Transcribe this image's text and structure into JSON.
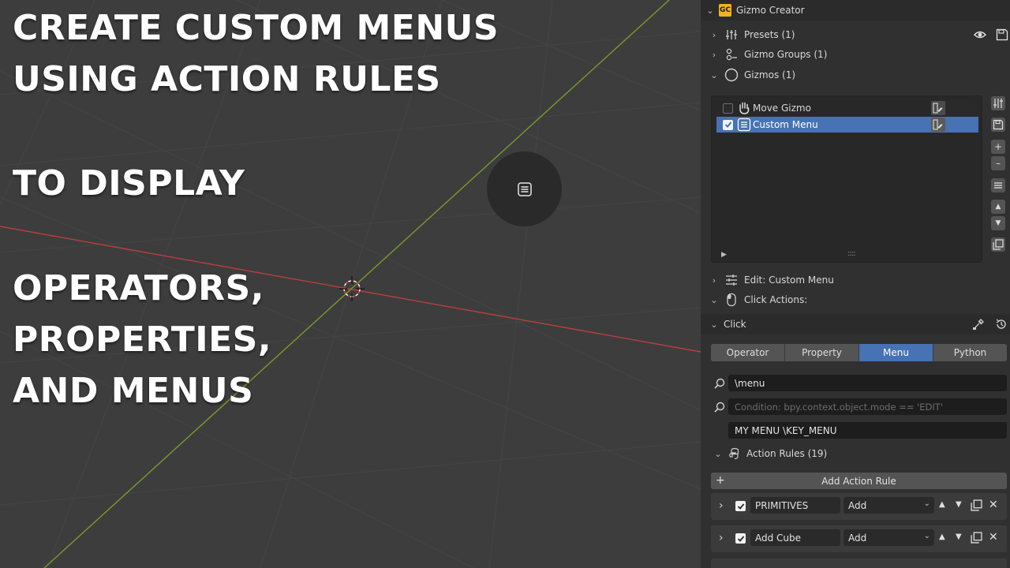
{
  "overlay": {
    "line1": "CREATE CUSTOM MENUS",
    "line2": "USING ACTION RULES",
    "line3": "TO DISPLAY",
    "line4": "OPERATORS,",
    "line5": "PROPERTIES,",
    "line6": "AND MENUS"
  },
  "colors": {
    "accent": "#4772b3",
    "x_axis": "#b83f3f",
    "y_axis": "#7a9a2c",
    "badge": "#f0b31b",
    "viewport_bg": "#3d3d3d",
    "panel_bg": "#303030"
  },
  "panel": {
    "badge": "GC",
    "title": "Gizmo Creator",
    "presets": "Presets (1)",
    "gizmo_groups": "Gizmo Groups (1)",
    "gizmos": "Gizmos (1)"
  },
  "gizmo_list": [
    {
      "label": "Move Gizmo",
      "checked": false,
      "icon": "hand-icon"
    },
    {
      "label": "Custom Menu",
      "checked": true,
      "icon": "menu-icon"
    }
  ],
  "list_grip": "::::",
  "edit_section": "Edit: Custom Menu",
  "click_actions": "Click Actions:",
  "click_section": "Click",
  "tabs": [
    "Operator",
    "Property",
    "Menu",
    "Python"
  ],
  "active_tab": "Menu",
  "fields": {
    "search_value": "\\menu",
    "condition_placeholder": "Condition: bpy.context.object.mode == 'EDIT'",
    "menu_id": "MY MENU \\KEY_MENU"
  },
  "action_rules": {
    "title": "Action Rules (19)",
    "add_label": "Add Action Rule",
    "rules": [
      {
        "name": "PRIMITIVES",
        "type": "Add",
        "enabled": true
      },
      {
        "name": "Add Cube",
        "type": "Add",
        "enabled": true
      }
    ]
  }
}
